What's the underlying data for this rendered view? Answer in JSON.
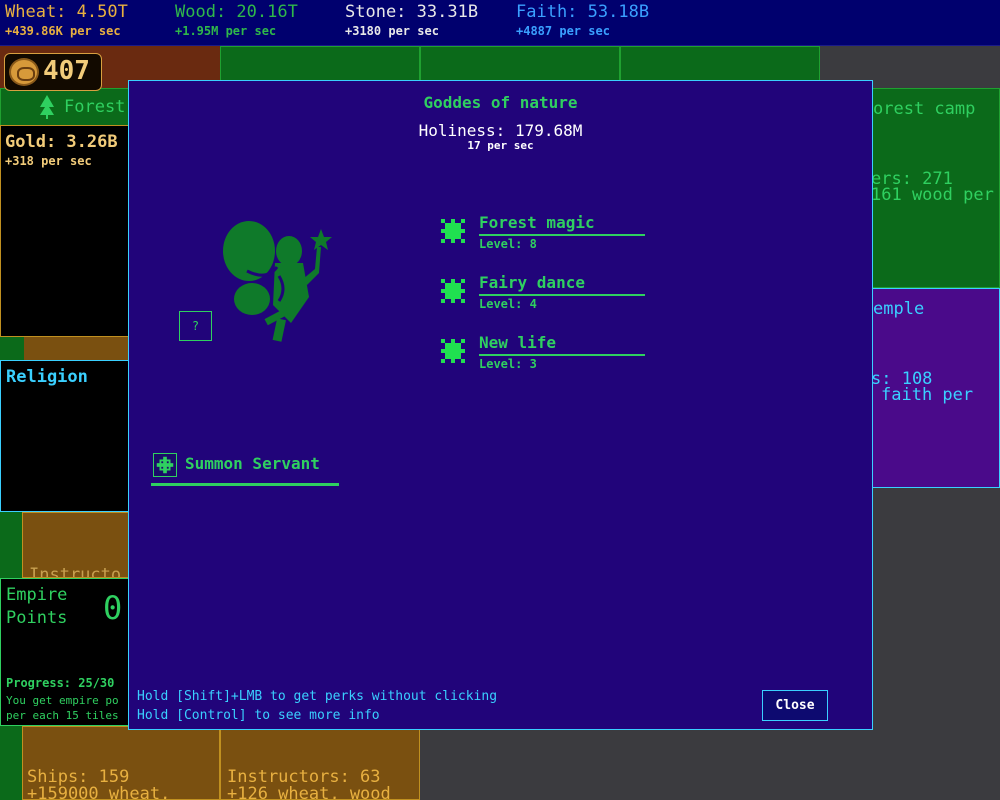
{
  "resources": [
    {
      "name": "Wheat: 4.50T",
      "rate": "+439.86K per sec"
    },
    {
      "name": "Wood: 20.16T",
      "rate": "+1.95M per sec"
    },
    {
      "name": "Stone: 33.31B",
      "rate": "+3180 per sec"
    },
    {
      "name": "Faith: 53.18B",
      "rate": "+4887 per sec"
    }
  ],
  "counter": {
    "value": "407",
    "icon": "coin-icon"
  },
  "tiles": {
    "forest": {
      "label": "Forest"
    },
    "gold": {
      "title": "Gold: 3.26B",
      "rate": "+318 per sec"
    },
    "religion": {
      "title": "Religion"
    },
    "instructors_peek": {
      "text": "Instructo"
    },
    "empire": {
      "title_line1": "Empire",
      "title_line2": "Points",
      "value": "0",
      "progress": "Progress: 25/30",
      "note_line1": "You get empire po",
      "note_line2": "per each 15 tiles"
    },
    "ships": {
      "title": "Ships: 159",
      "rate": "+159000 wheat,"
    },
    "instructors": {
      "title": "Instructors: 63",
      "rate": "+126 wheat, wood"
    },
    "forest_camp": {
      "title": "orest camp",
      "line1": "ers: 271",
      "line2": "161 wood per"
    },
    "temple": {
      "title": "emple",
      "line1": "s: 108",
      "line2": "faith per"
    }
  },
  "modal": {
    "title": "Goddes of nature",
    "holiness": "Holiness: 179.68M",
    "holiness_rate": "17 per sec",
    "help_label": "?",
    "portrait_icon": "fairy-icon",
    "perks": [
      {
        "name": "Forest magic",
        "level": "Level: 8"
      },
      {
        "name": "Fairy dance",
        "level": "Level: 4"
      },
      {
        "name": "New life",
        "level": "Level: 3"
      }
    ],
    "summon_label": "Summon Servant",
    "hint1": "Hold [Shift]+LMB to get perks without clicking",
    "hint2": "Hold [Control] to see more info",
    "close_label": "Close"
  },
  "colors": {
    "modal_bg": "#21047a",
    "accent_green": "#2fd060",
    "accent_cyan": "#3ad0ff",
    "topbar_bg": "#00006e"
  }
}
